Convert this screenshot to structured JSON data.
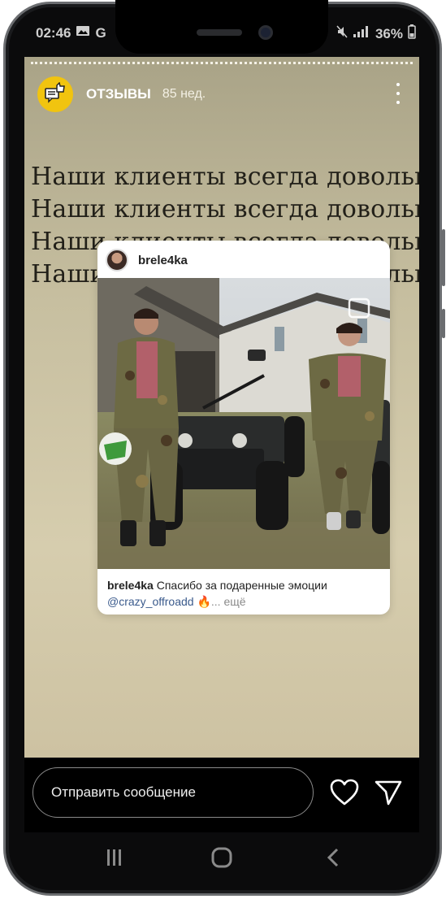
{
  "status": {
    "time": "02:46",
    "left_icons": [
      "image-icon",
      "google-icon"
    ],
    "battery": "36%",
    "right_icons": [
      "mute-icon",
      "signal-icon",
      "battery-icon"
    ]
  },
  "story": {
    "account_name": "ОТЗЫВЫ",
    "time_ago": "85 нед.",
    "avatar_icon": "thumbs-up-message-icon",
    "accent_color": "#f1c40f",
    "headline_lines": [
      "Наши клиенты всегда довольны",
      "Наши клиенты всегда довольны",
      "Наши клиенты всегда довольны",
      "Наши клиенты всегда довольны"
    ]
  },
  "post": {
    "username": "brele4ka",
    "caption_user": "brele4ka",
    "caption_text": "Спасибо за подаренные эмоции",
    "caption_tag": "@crazy_offroadd",
    "caption_emoji": "🔥",
    "caption_more": "... ещё"
  },
  "composer": {
    "placeholder": "Отправить сообщение",
    "like_icon": "heart-icon",
    "send_icon": "send-icon"
  },
  "navbar": {
    "icons": [
      "recents-icon",
      "home-icon",
      "back-icon"
    ]
  }
}
